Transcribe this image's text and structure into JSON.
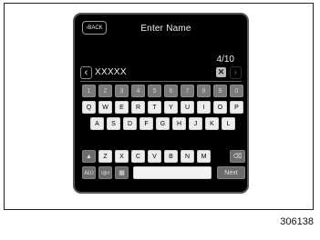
{
  "header": {
    "back_label": "BACK",
    "title": "Enter Name"
  },
  "input": {
    "value": "XXXXX",
    "counter": "4/10",
    "clear_label": "✕"
  },
  "keyboard": {
    "row_numbers": [
      "1",
      "2",
      "3",
      "4",
      "5",
      "6",
      "7",
      "8",
      "9",
      "0"
    ],
    "row_1": [
      "Q",
      "W",
      "E",
      "R",
      "T",
      "Y",
      "U",
      "I",
      "O",
      "P"
    ],
    "row_2": [
      "A",
      "S",
      "D",
      "F",
      "G",
      "H",
      "J",
      "K",
      "L"
    ],
    "row_3": [
      "Z",
      "X",
      "C",
      "V",
      "B",
      "N",
      "M"
    ],
    "abc_label": "ÂÉÜ",
    "sym_label": "!@#",
    "next_label": "Next"
  },
  "figure_number": "306138",
  "colors": {
    "screen_bg": "#000000",
    "key_bg": "#ececec",
    "num_key_bg": "#7a7a7a"
  }
}
